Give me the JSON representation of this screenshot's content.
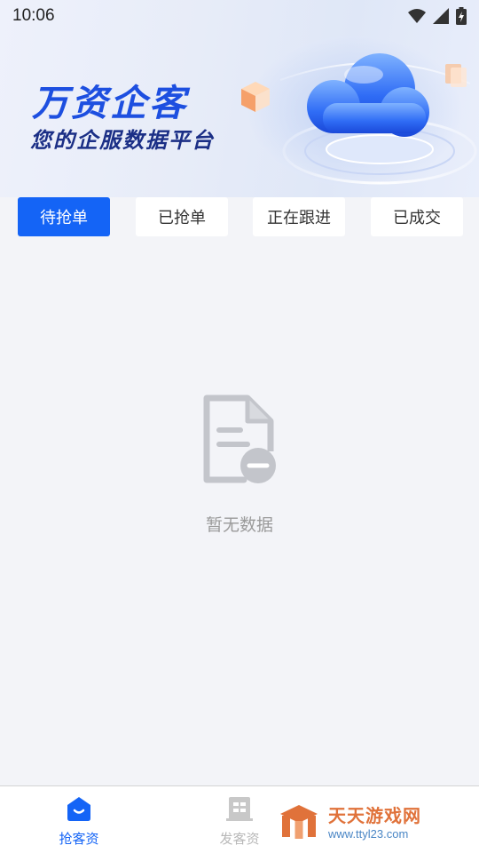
{
  "status_bar": {
    "time": "10:06",
    "icons": [
      "wifi-icon",
      "signal-icon",
      "battery-charging-icon"
    ]
  },
  "banner": {
    "title": "万资企客",
    "subtitle": "您的企服数据平台",
    "art": "cloud-3d-illustration",
    "colors": {
      "title": "#1d4fe0",
      "subtitle": "#1b2f86"
    }
  },
  "tabs": [
    {
      "label": "待抢单",
      "active": true
    },
    {
      "label": "已抢单",
      "active": false
    },
    {
      "label": "正在跟进",
      "active": false
    },
    {
      "label": "已成交",
      "active": false
    }
  ],
  "empty_state": {
    "icon": "empty-document-icon",
    "text": "暂无数据"
  },
  "bottom_nav": [
    {
      "label": "抢客资",
      "icon": "home-smile-icon",
      "active": true
    },
    {
      "label": "发客资",
      "icon": "building-icon",
      "active": false
    }
  ],
  "watermark": {
    "name": "天天游戏网",
    "url": "www.ttyl23.com"
  },
  "colors": {
    "accent": "#1464f6",
    "background": "#f3f4f8",
    "inactive_text": "#b8b8b8",
    "empty_text": "#9a9a9a"
  }
}
